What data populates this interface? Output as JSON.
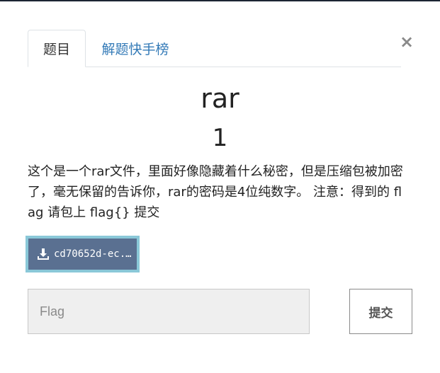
{
  "modal": {
    "close_label": "×",
    "tabs": [
      {
        "label": "题目",
        "active": true
      },
      {
        "label": "解题快手榜",
        "active": false
      }
    ],
    "challenge": {
      "name": "rar",
      "value": "1",
      "description": "这个是一个rar文件，里面好像隐藏着什么秘密，但是压缩包被加密了，毫无保留的告诉你，rar的密码是4位纯数字。 注意：得到的 flag 请包上 flag{} 提交"
    },
    "file": {
      "label": "cd70652d-ec...",
      "icon": "download-icon"
    },
    "flag_input": {
      "placeholder": "Flag",
      "value": ""
    },
    "submit_label": "提交"
  },
  "colors": {
    "accent_link": "#337ab7",
    "file_button_bg": "#5a7091",
    "file_button_border": "#8ac8d8",
    "top_border": "#1c2533"
  }
}
